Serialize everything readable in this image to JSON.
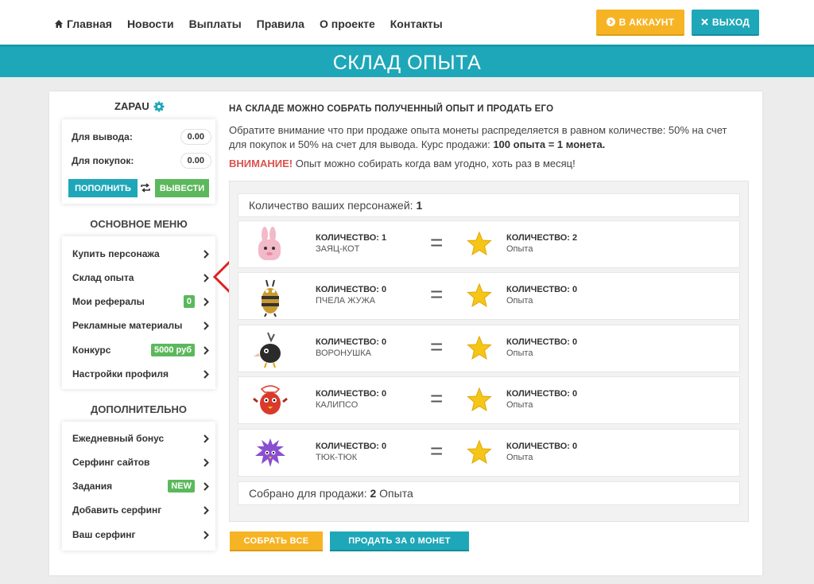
{
  "nav": {
    "items": [
      {
        "label": "Главная",
        "icon": "home-icon"
      },
      {
        "label": "Новости"
      },
      {
        "label": "Выплаты"
      },
      {
        "label": "Правила"
      },
      {
        "label": "О проекте"
      },
      {
        "label": "Контакты"
      }
    ],
    "account_label": "В АККАУНТ",
    "exit_label": "ВЫХОД"
  },
  "banner": {
    "title": "СКЛАД ОПЫТА"
  },
  "user": {
    "name": "ZAPAU"
  },
  "balance": {
    "withdraw_label": "Для вывода:",
    "withdraw_value": "0.00",
    "purchase_label": "Для покупок:",
    "purchase_value": "0.00",
    "fill_label": "ПОПОЛНИТЬ",
    "withdraw_button": "ВЫВЕСТИ"
  },
  "main_menu": {
    "title": "ОСНОВНОЕ МЕНЮ",
    "items": [
      {
        "label": "Купить персонажа"
      },
      {
        "label": "Склад опыта"
      },
      {
        "label": "Мои рефералы",
        "badge": "0"
      },
      {
        "label": "Рекламные материалы"
      },
      {
        "label": "Конкурс",
        "badge": "5000 руб"
      },
      {
        "label": "Настройки профиля"
      }
    ]
  },
  "extra_menu": {
    "title": "ДОПОЛНИТЕЛЬНО",
    "items": [
      {
        "label": "Ежедневный бонус"
      },
      {
        "label": "Серфинг сайтов"
      },
      {
        "label": "Задания",
        "badge": "NEW"
      },
      {
        "label": "Добавить серфинг"
      },
      {
        "label": "Ваш серфинг"
      }
    ]
  },
  "content": {
    "heading": "НА СКЛАДЕ МОЖНО СОБРАТЬ ПОЛУЧЕННЫЙ ОПЫТ И ПРОДАТЬ ЕГО",
    "desc": "Обратите внимание что при продаже опыта монеты распределяется в равном количестве: 50% на счет для покупок и 50% на счет для вывода. Курс продажи:",
    "rate": "100 опыта = 1 монета.",
    "warn_bold": "ВНИМАНИЕ!",
    "warn_text": "Опыт можно собирать когда вам угодно, хоть раз в месяц!",
    "count_label": "Количество ваших персонажей:",
    "count_value": "1",
    "characters": [
      {
        "qty": "КОЛИЧЕСТВО: 1",
        "name": "ЗАЯЦ-КОТ",
        "exp_qty": "КОЛИЧЕСТВО: 2",
        "exp_label": "Опыта",
        "color": "#f3b9c9"
      },
      {
        "qty": "КОЛИЧЕСТВО: 0",
        "name": "ПЧЕЛА ЖУЖА",
        "exp_qty": "КОЛИЧЕСТВО: 0",
        "exp_label": "Опыта",
        "color": "#c99a2e"
      },
      {
        "qty": "КОЛИЧЕСТВО: 0",
        "name": "ВОРОНУШКА",
        "exp_qty": "КОЛИЧЕСТВО: 0",
        "exp_label": "Опыта",
        "color": "#2b2b2b"
      },
      {
        "qty": "КОЛИЧЕСТВО: 0",
        "name": "КАЛИПСО",
        "exp_qty": "КОЛИЧЕСТВО: 0",
        "exp_label": "Опыта",
        "color": "#d93a2b"
      },
      {
        "qty": "КОЛИЧЕСТВО: 0",
        "name": "ТЮК-ТЮК",
        "exp_qty": "КОЛИЧЕСТВО: 0",
        "exp_label": "Опыта",
        "color": "#8a4fd1"
      }
    ],
    "collected_label": "Собрано для продажи:",
    "collected_value": "2",
    "collected_unit": "Опыта",
    "collect_all": "СОБРАТЬ ВСЕ",
    "sell": "ПРОДАТЬ ЗА 0 МОНЕТ"
  },
  "colors": {
    "teal": "#1ea7b8",
    "orange": "#f6b424",
    "green": "#5cb85c",
    "red": "#d9534f"
  }
}
